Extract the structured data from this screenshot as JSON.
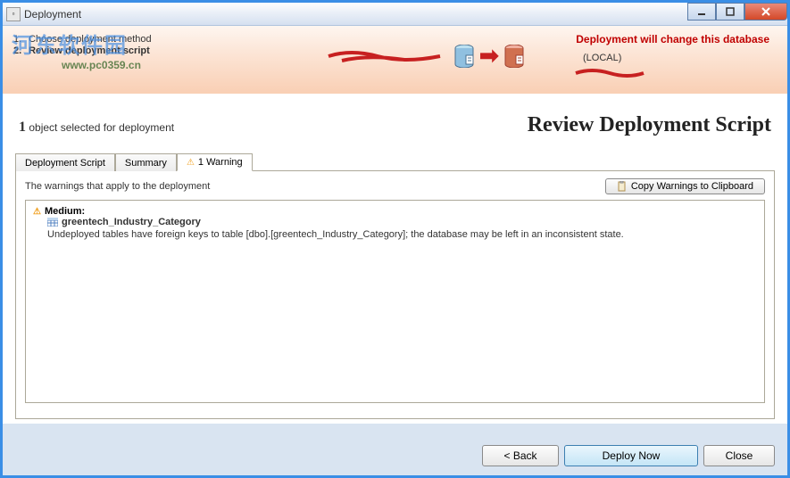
{
  "window": {
    "title": "Deployment"
  },
  "watermark": {
    "main": "河东软件园",
    "sub": "www.pc0359.cn"
  },
  "steps": {
    "items": [
      {
        "num": "1.",
        "label": "Choose deployment method"
      },
      {
        "num": "2.",
        "label": "Review deployment script"
      }
    ]
  },
  "header": {
    "warning": "Deployment will change this database",
    "localLabel": "(LOCAL)"
  },
  "section": {
    "count": "1",
    "countLabel": "object selected for deployment",
    "title": "Review Deployment Script"
  },
  "tabs": {
    "items": [
      {
        "label": "Deployment Script"
      },
      {
        "label": "Summary"
      },
      {
        "label": "1 Warning"
      }
    ]
  },
  "tabContent": {
    "headerText": "The warnings that apply to the deployment",
    "copyBtn": "Copy Warnings to Clipboard"
  },
  "warnings": {
    "items": [
      {
        "severity": "Medium:",
        "name": "greentech_Industry_Category",
        "desc": "Undeployed tables have foreign keys to table [dbo].[greentech_Industry_Category]; the database may be left in an inconsistent state."
      }
    ]
  },
  "buttons": {
    "back": "< Back",
    "deploy": "Deploy Now",
    "close": "Close"
  }
}
